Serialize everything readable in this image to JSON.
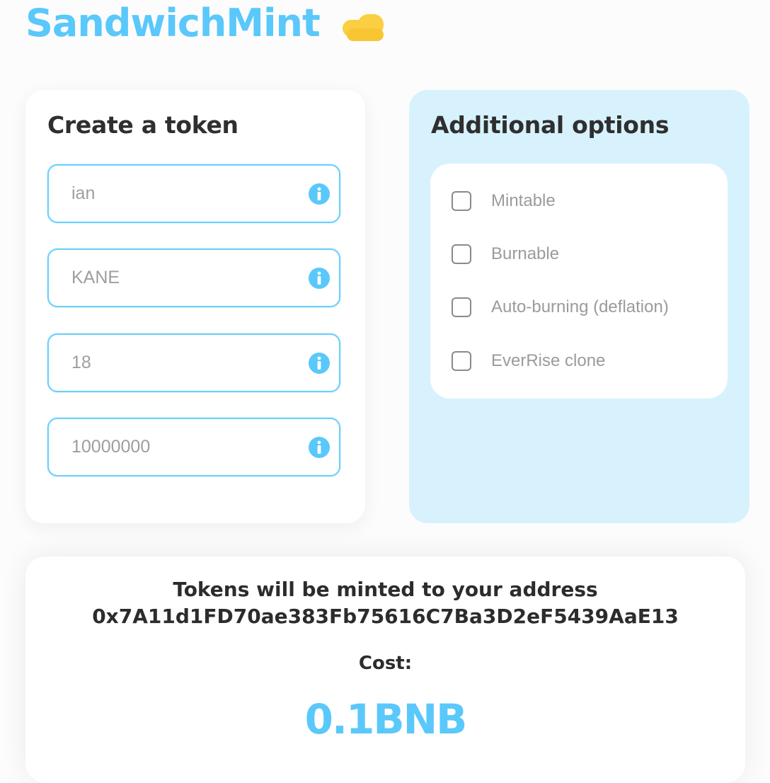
{
  "brand": {
    "name": "SandwichMint",
    "accent": "#5ac8fa",
    "icon": "sandwich-icon"
  },
  "create_token": {
    "title": "Create a token",
    "fields": [
      {
        "value": "ian",
        "icon": "info-icon"
      },
      {
        "value": "KANE",
        "icon": "info-icon"
      },
      {
        "value": "18",
        "icon": "info-icon"
      },
      {
        "value": "10000000",
        "icon": "info-icon"
      }
    ]
  },
  "additional_options": {
    "title": "Additional options",
    "options": [
      {
        "label": "Mintable",
        "checked": false
      },
      {
        "label": "Burnable",
        "checked": false
      },
      {
        "label": "Auto-burning (deflation)",
        "checked": false
      },
      {
        "label": "EverRise clone",
        "checked": false
      }
    ]
  },
  "mint": {
    "caption": "Tokens will be minted to your address",
    "address": "0x7A11d1FD70ae383Fb75616C7Ba3D2eF5439AaE13",
    "cost_label": "Cost:",
    "cost_value": "0.1BNB"
  }
}
